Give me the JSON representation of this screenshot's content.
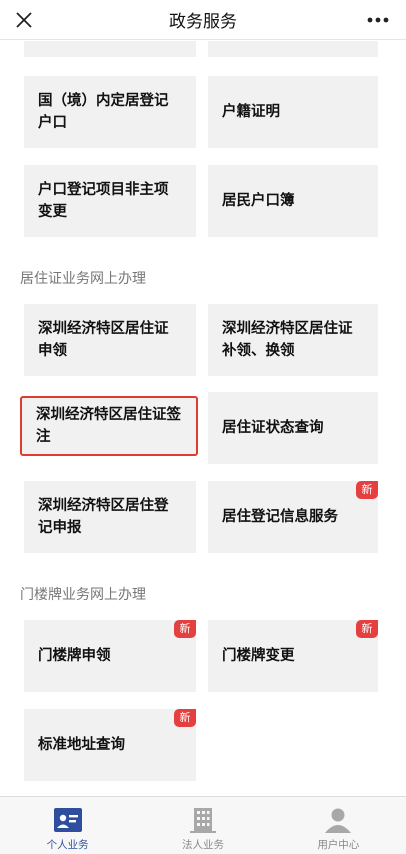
{
  "header": {
    "title": "政务服务",
    "close_icon": "close-icon",
    "more_icon": "more-icon"
  },
  "group_household": {
    "items": [
      {
        "label": "国（境）内定居登记户口"
      },
      {
        "label": "户籍证明"
      },
      {
        "label": "户口登记项目非主项变更"
      },
      {
        "label": "居民户口簿"
      }
    ]
  },
  "group_residence": {
    "title": "居住证业务网上办理",
    "items": [
      {
        "label": "深圳经济特区居住证申领"
      },
      {
        "label": "深圳经济特区居住证补领、换领"
      },
      {
        "label": "深圳经济特区居住证签注"
      },
      {
        "label": "居住证状态查询"
      },
      {
        "label": "深圳经济特区居住登记申报"
      },
      {
        "label": "居住登记信息服务",
        "badge": "新"
      }
    ]
  },
  "group_doorplate": {
    "title": "门楼牌业务网上办理",
    "items": [
      {
        "label": "门楼牌申领",
        "badge": "新"
      },
      {
        "label": "门楼牌变更",
        "badge": "新"
      },
      {
        "label": "标准地址查询",
        "badge": "新"
      }
    ]
  },
  "tabbar": {
    "tabs": [
      {
        "label": "个人业务",
        "icon": "personal-business-icon"
      },
      {
        "label": "法人业务",
        "icon": "building-icon"
      },
      {
        "label": "用户中心",
        "icon": "user-icon"
      }
    ],
    "active_color": "#2f4f9e"
  },
  "colors": {
    "highlight": "#e03b30",
    "badge": "#e5403f",
    "tile_bg": "#f1f1f1"
  }
}
